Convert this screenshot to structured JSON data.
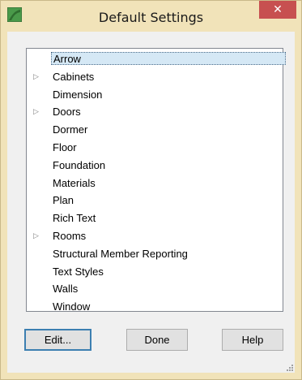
{
  "window": {
    "title": "Default Settings",
    "close_label": "✕",
    "accent_color": "#f1e3b9",
    "close_color": "#c75050"
  },
  "tree": {
    "items": [
      {
        "label": "Arrow",
        "expandable": false,
        "selected": true
      },
      {
        "label": "Cabinets",
        "expandable": true
      },
      {
        "label": "Dimension",
        "expandable": false
      },
      {
        "label": "Doors",
        "expandable": true
      },
      {
        "label": "Dormer",
        "expandable": false
      },
      {
        "label": "Floor",
        "expandable": false
      },
      {
        "label": "Foundation",
        "expandable": false
      },
      {
        "label": "Materials",
        "expandable": false
      },
      {
        "label": "Plan",
        "expandable": false
      },
      {
        "label": "Rich Text",
        "expandable": false
      },
      {
        "label": "Rooms",
        "expandable": true
      },
      {
        "label": "Structural Member Reporting",
        "expandable": false
      },
      {
        "label": "Text Styles",
        "expandable": false
      },
      {
        "label": "Walls",
        "expandable": false
      },
      {
        "label": "Window",
        "expandable": false
      }
    ],
    "expand_glyph": "▷"
  },
  "buttons": {
    "edit_label": "Edit...",
    "done_label": "Done",
    "help_label": "Help"
  }
}
